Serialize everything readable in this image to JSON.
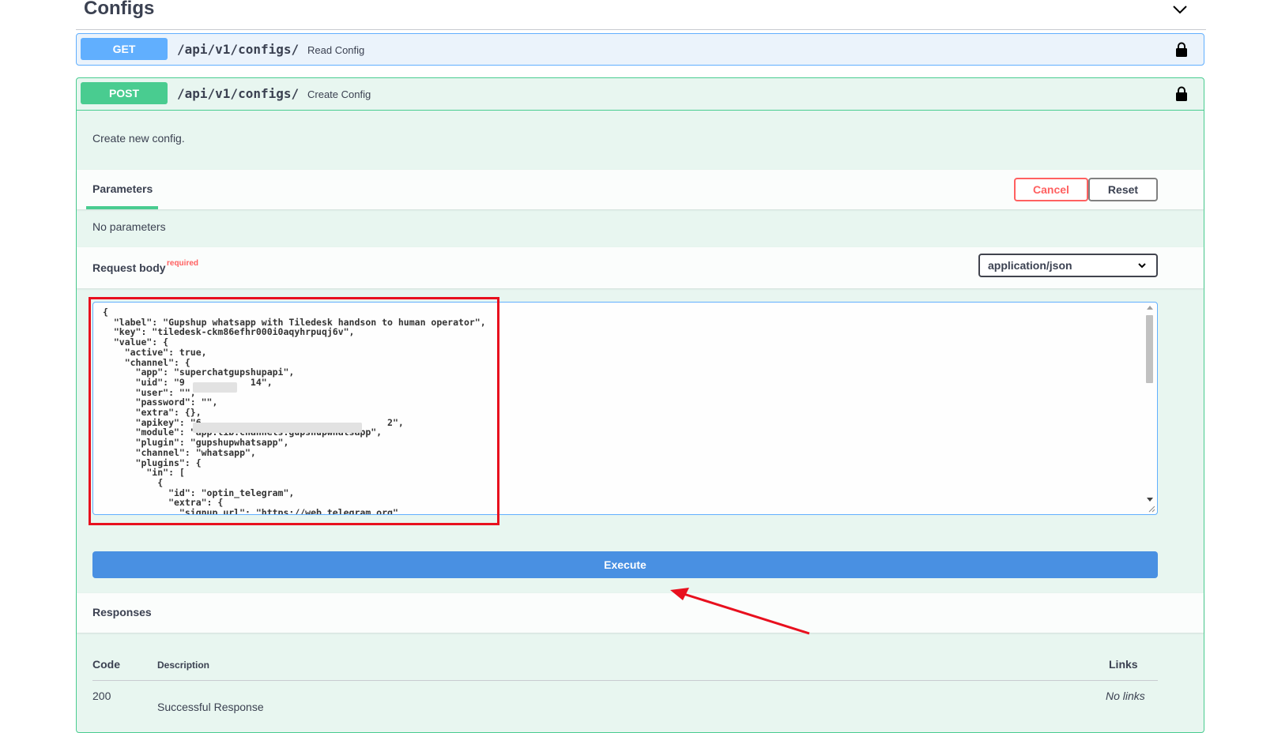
{
  "section": {
    "title": "Configs"
  },
  "get_op": {
    "method": "GET",
    "path": "/api/v1/configs/",
    "summary": "Read Config"
  },
  "post_op": {
    "method": "POST",
    "path": "/api/v1/configs/",
    "summary": "Create Config",
    "description": "Create new config.",
    "parameters_tab": "Parameters",
    "cancel_label": "Cancel",
    "reset_label": "Reset",
    "no_parameters": "No parameters",
    "request_body_label": "Request body",
    "required_label": "required",
    "content_type": "application/json",
    "body_text": "{\n  \"label\": \"Gupshup whatsapp with Tiledesk handson to human operator\",\n  \"key\": \"tiledesk-ckm86efhr000i0aqyhrpuqj6v\",\n  \"value\": {\n    \"active\": true,\n    \"channel\": {\n      \"app\": \"superchatgupshupapi\",\n      \"uid\": \"9            14\",\n      \"user\": \"\",\n      \"password\": \"\",\n      \"extra\": {},\n      \"apikey\": \"6                                  2\",\n      \"module\": \"app.lib.channels.gupshupwhatsapp\",\n      \"plugin\": \"gupshupwhatsapp\",\n      \"channel\": \"whatsapp\",\n      \"plugins\": {\n        \"in\": [\n          {\n            \"id\": \"optin_telegram\",\n            \"extra\": {\n              \"signup_url\": \"https://web.telegram.org\"",
    "execute_label": "Execute",
    "responses_label": "Responses",
    "responses_table": {
      "headers": {
        "code": "Code",
        "description": "Description",
        "links": "Links"
      },
      "rows": [
        {
          "code": "200",
          "description": "Successful Response",
          "links": "No links"
        }
      ]
    }
  },
  "colors": {
    "get_accent": "#61affe",
    "post_accent": "#49cc90",
    "execute": "#4990e2",
    "cancel": "#ff6060",
    "annotation": "#e8101e"
  }
}
